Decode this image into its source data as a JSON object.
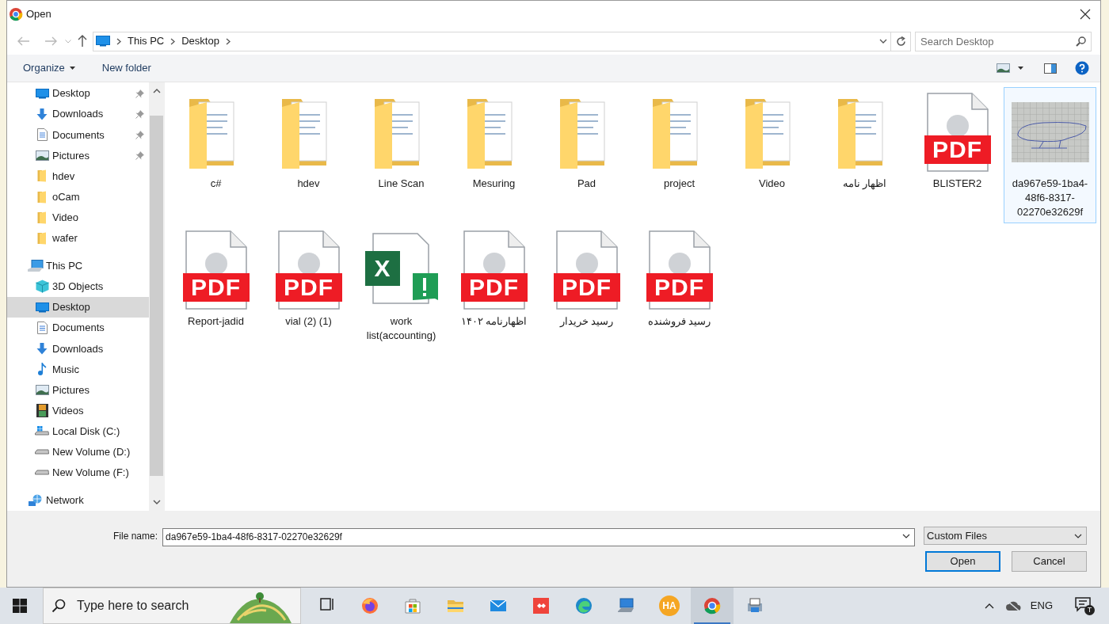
{
  "window": {
    "title": "Open"
  },
  "address": {
    "crumbs": [
      "This PC",
      "Desktop"
    ],
    "search_placeholder": "Search Desktop"
  },
  "toolbar": {
    "organize": "Organize",
    "new_folder": "New folder"
  },
  "sidebar": {
    "quick_access": [
      {
        "label": "Desktop",
        "kind": "desktop",
        "pinned": true,
        "selected": false
      },
      {
        "label": "Downloads",
        "kind": "downloads",
        "pinned": true,
        "selected": false
      },
      {
        "label": "Documents",
        "kind": "documents",
        "pinned": true,
        "selected": false
      },
      {
        "label": "Pictures",
        "kind": "pictures",
        "pinned": true,
        "selected": false
      },
      {
        "label": "hdev",
        "kind": "folder",
        "pinned": false,
        "selected": false
      },
      {
        "label": "oCam",
        "kind": "folder",
        "pinned": false,
        "selected": false
      },
      {
        "label": "Video",
        "kind": "folder",
        "pinned": false,
        "selected": false
      },
      {
        "label": "wafer",
        "kind": "folder",
        "pinned": false,
        "selected": false
      }
    ],
    "this_pc": {
      "label": "This PC",
      "children": [
        {
          "label": "3D Objects",
          "kind": "cube",
          "selected": false
        },
        {
          "label": "Desktop",
          "kind": "desktop",
          "selected": true
        },
        {
          "label": "Documents",
          "kind": "documents",
          "selected": false
        },
        {
          "label": "Downloads",
          "kind": "downloads",
          "selected": false
        },
        {
          "label": "Music",
          "kind": "music",
          "selected": false
        },
        {
          "label": "Pictures",
          "kind": "pictures",
          "selected": false
        },
        {
          "label": "Videos",
          "kind": "videos",
          "selected": false
        },
        {
          "label": "Local Disk (C:)",
          "kind": "disk",
          "selected": false
        },
        {
          "label": "New Volume (D:)",
          "kind": "drive",
          "selected": false
        },
        {
          "label": "New Volume (F:)",
          "kind": "drive",
          "selected": false
        }
      ]
    },
    "network": {
      "label": "Network"
    }
  },
  "files": [
    {
      "name": "c#",
      "kind": "folder",
      "selected": false
    },
    {
      "name": "hdev",
      "kind": "folder",
      "selected": false
    },
    {
      "name": "Line Scan",
      "kind": "folder",
      "selected": false
    },
    {
      "name": "Mesuring",
      "kind": "folder",
      "selected": false
    },
    {
      "name": "Pad",
      "kind": "folder",
      "selected": false
    },
    {
      "name": "project",
      "kind": "folder",
      "selected": false
    },
    {
      "name": "Video",
      "kind": "folder",
      "selected": false
    },
    {
      "name": "اظهار نامه",
      "kind": "folder",
      "selected": false
    },
    {
      "name": "BLISTER2",
      "kind": "pdf",
      "badge": "PDF",
      "selected": false
    },
    {
      "name": "da967e59-1ba4-48f6-8317-02270e32629f",
      "kind": "image",
      "selected": true
    },
    {
      "name": "Report-jadid",
      "kind": "pdf",
      "badge": "PDF",
      "selected": false
    },
    {
      "name": "vial (2) (1)",
      "kind": "pdf",
      "badge": "PDF",
      "selected": false
    },
    {
      "name": "work list(accounting)",
      "kind": "excel",
      "badge": "X",
      "selected": false
    },
    {
      "name": "اظهارنامه ۱۴۰۲",
      "kind": "pdf",
      "badge": "PDF",
      "selected": false
    },
    {
      "name": "رسید خریدار",
      "kind": "pdf",
      "badge": "PDF",
      "selected": false
    },
    {
      "name": "رسید فروشنده",
      "kind": "pdf",
      "badge": "PDF",
      "selected": false
    }
  ],
  "footer": {
    "file_name_label": "File name:",
    "file_name": "da967e59-1ba4-48f6-8317-02270e32629f",
    "filter": "Custom Files",
    "buttons": [
      {
        "label": "Open",
        "default": true
      },
      {
        "label": "Cancel",
        "default": false
      }
    ]
  },
  "taskbar": {
    "search_placeholder": "Type here to search",
    "apps": [
      {
        "kind": "taskview",
        "active": false
      },
      {
        "kind": "firefox",
        "active": false
      },
      {
        "kind": "store",
        "active": false
      },
      {
        "kind": "explorer",
        "active": false
      },
      {
        "kind": "mail",
        "active": false
      },
      {
        "kind": "anydesk",
        "active": false
      },
      {
        "kind": "edge",
        "active": false
      },
      {
        "kind": "remote",
        "active": false
      },
      {
        "kind": "ha",
        "label": "HA",
        "active": false
      },
      {
        "kind": "chrome",
        "active": true
      },
      {
        "kind": "printer",
        "active": false
      }
    ],
    "language": "ENG",
    "notification_badge": "T"
  }
}
